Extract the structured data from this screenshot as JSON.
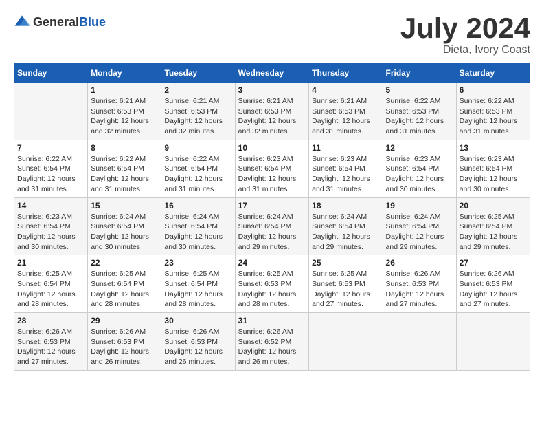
{
  "logo": {
    "general": "General",
    "blue": "Blue"
  },
  "title": {
    "month": "July 2024",
    "location": "Dieta, Ivory Coast"
  },
  "calendar": {
    "headers": [
      "Sunday",
      "Monday",
      "Tuesday",
      "Wednesday",
      "Thursday",
      "Friday",
      "Saturday"
    ],
    "weeks": [
      [
        {
          "day": "",
          "sunrise": "",
          "sunset": "",
          "daylight": ""
        },
        {
          "day": "1",
          "sunrise": "Sunrise: 6:21 AM",
          "sunset": "Sunset: 6:53 PM",
          "daylight": "Daylight: 12 hours and 32 minutes."
        },
        {
          "day": "2",
          "sunrise": "Sunrise: 6:21 AM",
          "sunset": "Sunset: 6:53 PM",
          "daylight": "Daylight: 12 hours and 32 minutes."
        },
        {
          "day": "3",
          "sunrise": "Sunrise: 6:21 AM",
          "sunset": "Sunset: 6:53 PM",
          "daylight": "Daylight: 12 hours and 32 minutes."
        },
        {
          "day": "4",
          "sunrise": "Sunrise: 6:21 AM",
          "sunset": "Sunset: 6:53 PM",
          "daylight": "Daylight: 12 hours and 31 minutes."
        },
        {
          "day": "5",
          "sunrise": "Sunrise: 6:22 AM",
          "sunset": "Sunset: 6:53 PM",
          "daylight": "Daylight: 12 hours and 31 minutes."
        },
        {
          "day": "6",
          "sunrise": "Sunrise: 6:22 AM",
          "sunset": "Sunset: 6:53 PM",
          "daylight": "Daylight: 12 hours and 31 minutes."
        }
      ],
      [
        {
          "day": "7",
          "sunrise": "Sunrise: 6:22 AM",
          "sunset": "Sunset: 6:54 PM",
          "daylight": "Daylight: 12 hours and 31 minutes."
        },
        {
          "day": "8",
          "sunrise": "Sunrise: 6:22 AM",
          "sunset": "Sunset: 6:54 PM",
          "daylight": "Daylight: 12 hours and 31 minutes."
        },
        {
          "day": "9",
          "sunrise": "Sunrise: 6:22 AM",
          "sunset": "Sunset: 6:54 PM",
          "daylight": "Daylight: 12 hours and 31 minutes."
        },
        {
          "day": "10",
          "sunrise": "Sunrise: 6:23 AM",
          "sunset": "Sunset: 6:54 PM",
          "daylight": "Daylight: 12 hours and 31 minutes."
        },
        {
          "day": "11",
          "sunrise": "Sunrise: 6:23 AM",
          "sunset": "Sunset: 6:54 PM",
          "daylight": "Daylight: 12 hours and 31 minutes."
        },
        {
          "day": "12",
          "sunrise": "Sunrise: 6:23 AM",
          "sunset": "Sunset: 6:54 PM",
          "daylight": "Daylight: 12 hours and 30 minutes."
        },
        {
          "day": "13",
          "sunrise": "Sunrise: 6:23 AM",
          "sunset": "Sunset: 6:54 PM",
          "daylight": "Daylight: 12 hours and 30 minutes."
        }
      ],
      [
        {
          "day": "14",
          "sunrise": "Sunrise: 6:23 AM",
          "sunset": "Sunset: 6:54 PM",
          "daylight": "Daylight: 12 hours and 30 minutes."
        },
        {
          "day": "15",
          "sunrise": "Sunrise: 6:24 AM",
          "sunset": "Sunset: 6:54 PM",
          "daylight": "Daylight: 12 hours and 30 minutes."
        },
        {
          "day": "16",
          "sunrise": "Sunrise: 6:24 AM",
          "sunset": "Sunset: 6:54 PM",
          "daylight": "Daylight: 12 hours and 30 minutes."
        },
        {
          "day": "17",
          "sunrise": "Sunrise: 6:24 AM",
          "sunset": "Sunset: 6:54 PM",
          "daylight": "Daylight: 12 hours and 29 minutes."
        },
        {
          "day": "18",
          "sunrise": "Sunrise: 6:24 AM",
          "sunset": "Sunset: 6:54 PM",
          "daylight": "Daylight: 12 hours and 29 minutes."
        },
        {
          "day": "19",
          "sunrise": "Sunrise: 6:24 AM",
          "sunset": "Sunset: 6:54 PM",
          "daylight": "Daylight: 12 hours and 29 minutes."
        },
        {
          "day": "20",
          "sunrise": "Sunrise: 6:25 AM",
          "sunset": "Sunset: 6:54 PM",
          "daylight": "Daylight: 12 hours and 29 minutes."
        }
      ],
      [
        {
          "day": "21",
          "sunrise": "Sunrise: 6:25 AM",
          "sunset": "Sunset: 6:54 PM",
          "daylight": "Daylight: 12 hours and 28 minutes."
        },
        {
          "day": "22",
          "sunrise": "Sunrise: 6:25 AM",
          "sunset": "Sunset: 6:54 PM",
          "daylight": "Daylight: 12 hours and 28 minutes."
        },
        {
          "day": "23",
          "sunrise": "Sunrise: 6:25 AM",
          "sunset": "Sunset: 6:54 PM",
          "daylight": "Daylight: 12 hours and 28 minutes."
        },
        {
          "day": "24",
          "sunrise": "Sunrise: 6:25 AM",
          "sunset": "Sunset: 6:53 PM",
          "daylight": "Daylight: 12 hours and 28 minutes."
        },
        {
          "day": "25",
          "sunrise": "Sunrise: 6:25 AM",
          "sunset": "Sunset: 6:53 PM",
          "daylight": "Daylight: 12 hours and 27 minutes."
        },
        {
          "day": "26",
          "sunrise": "Sunrise: 6:26 AM",
          "sunset": "Sunset: 6:53 PM",
          "daylight": "Daylight: 12 hours and 27 minutes."
        },
        {
          "day": "27",
          "sunrise": "Sunrise: 6:26 AM",
          "sunset": "Sunset: 6:53 PM",
          "daylight": "Daylight: 12 hours and 27 minutes."
        }
      ],
      [
        {
          "day": "28",
          "sunrise": "Sunrise: 6:26 AM",
          "sunset": "Sunset: 6:53 PM",
          "daylight": "Daylight: 12 hours and 27 minutes."
        },
        {
          "day": "29",
          "sunrise": "Sunrise: 6:26 AM",
          "sunset": "Sunset: 6:53 PM",
          "daylight": "Daylight: 12 hours and 26 minutes."
        },
        {
          "day": "30",
          "sunrise": "Sunrise: 6:26 AM",
          "sunset": "Sunset: 6:53 PM",
          "daylight": "Daylight: 12 hours and 26 minutes."
        },
        {
          "day": "31",
          "sunrise": "Sunrise: 6:26 AM",
          "sunset": "Sunset: 6:52 PM",
          "daylight": "Daylight: 12 hours and 26 minutes."
        },
        {
          "day": "",
          "sunrise": "",
          "sunset": "",
          "daylight": ""
        },
        {
          "day": "",
          "sunrise": "",
          "sunset": "",
          "daylight": ""
        },
        {
          "day": "",
          "sunrise": "",
          "sunset": "",
          "daylight": ""
        }
      ]
    ]
  }
}
